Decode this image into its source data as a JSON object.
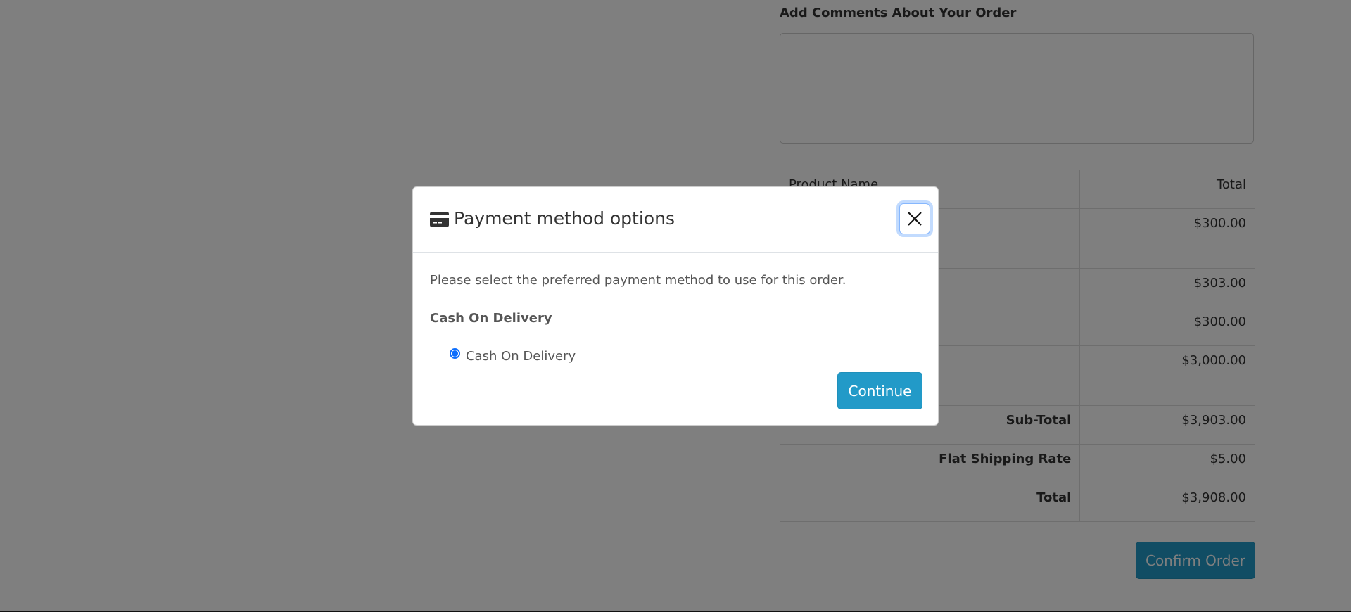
{
  "background": {
    "comments_label": "Add Comments About Your Order",
    "comments_value": "",
    "table": {
      "header": [
        "Product Name",
        "Total"
      ],
      "rows": [
        {
          "label": "",
          "value": "$300.00"
        },
        {
          "label": "",
          "value": "$303.00"
        },
        {
          "label": "",
          "value": "$300.00"
        },
        {
          "label": "",
          "value": "$3,000.00"
        }
      ],
      "totals": [
        {
          "label": "Sub-Total",
          "value": "$3,903.00"
        },
        {
          "label": "Flat Shipping Rate",
          "value": "$5.00"
        },
        {
          "label": "Total",
          "value": "$3,908.00"
        }
      ]
    },
    "confirm_label": "Confirm Order"
  },
  "modal": {
    "title": "Payment method options",
    "icon": "credit-card-icon",
    "intro": "Please select the preferred payment method to use for this order.",
    "method_group": "Cash On Delivery",
    "option_label": "Cash On Delivery",
    "option_selected": true,
    "continue_label": "Continue"
  },
  "colors": {
    "accent": "#229ac8",
    "radio": "#0d6efd",
    "backdrop": "rgba(0,0,0,0.5)"
  }
}
